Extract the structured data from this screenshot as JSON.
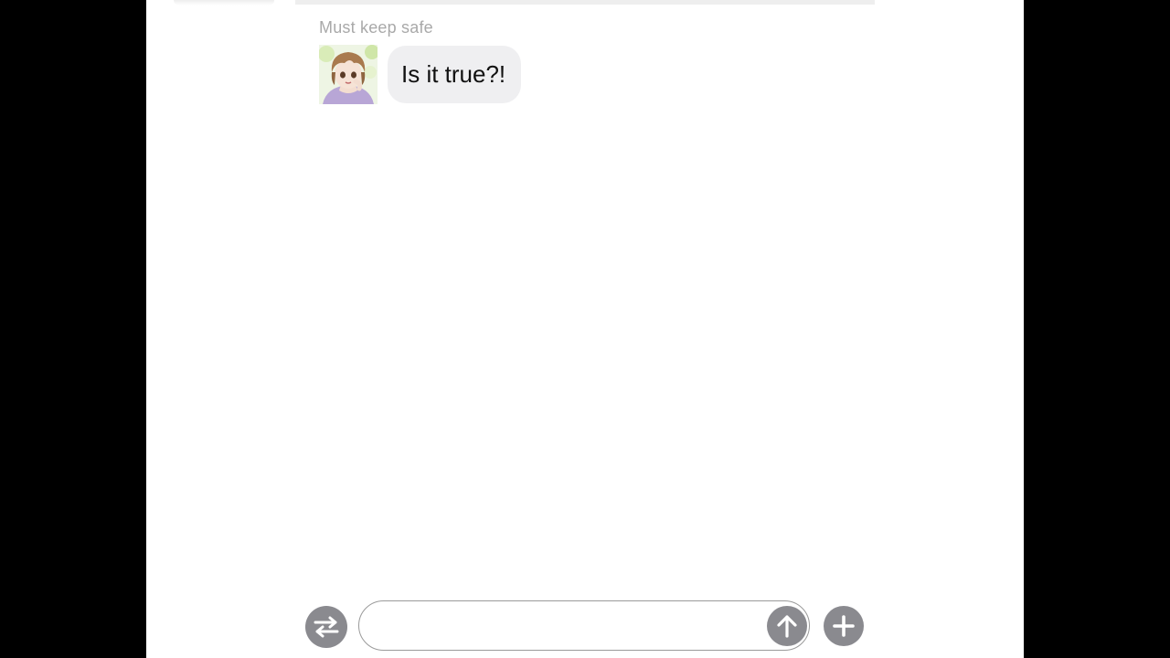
{
  "chat": {
    "messages": [
      {
        "sender": "Must keep safe",
        "avatar_icon": "anime-avatar",
        "text": "Is it true?!"
      }
    ]
  },
  "composer": {
    "input_value": "",
    "switch_icon": "swap-arrows-icon",
    "send_icon": "arrow-up-icon",
    "add_icon": "plus-icon"
  },
  "colors": {
    "background": "#ffffff",
    "letterbox": "#000000",
    "bubble": "#efeff1",
    "sender_name": "#a9a9a9",
    "button_gray": "#8a8a8f"
  }
}
